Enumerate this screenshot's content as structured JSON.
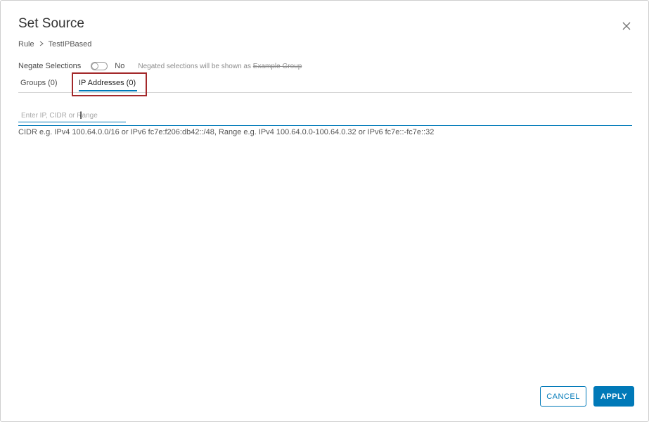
{
  "dialog": {
    "title": "Set Source",
    "close_icon": "close-icon"
  },
  "breadcrumb": {
    "items": [
      "Rule",
      "TestIPBased"
    ],
    "separator": ">"
  },
  "negate": {
    "label": "Negate Selections",
    "toggle_state": "No",
    "note_prefix": "Negated selections will be shown as",
    "note_example": "Example Group"
  },
  "tabs": [
    {
      "label": "Groups (0)",
      "active": false
    },
    {
      "label": "IP Addresses (0)",
      "active": true
    }
  ],
  "ip_input": {
    "placeholder": "Enter IP, CIDR or Range",
    "value": ""
  },
  "hint": "CIDR e.g. IPv4 100.64.0.0/16 or IPv6 fc7e:f206:db42::/48, Range e.g. IPv4 100.64.0.0-100.64.0.32 or IPv6 fc7e::-fc7e::32",
  "buttons": {
    "cancel": "CANCEL",
    "apply": "APPLY"
  },
  "colors": {
    "accent": "#0079b8",
    "highlight": "#a3282a"
  }
}
